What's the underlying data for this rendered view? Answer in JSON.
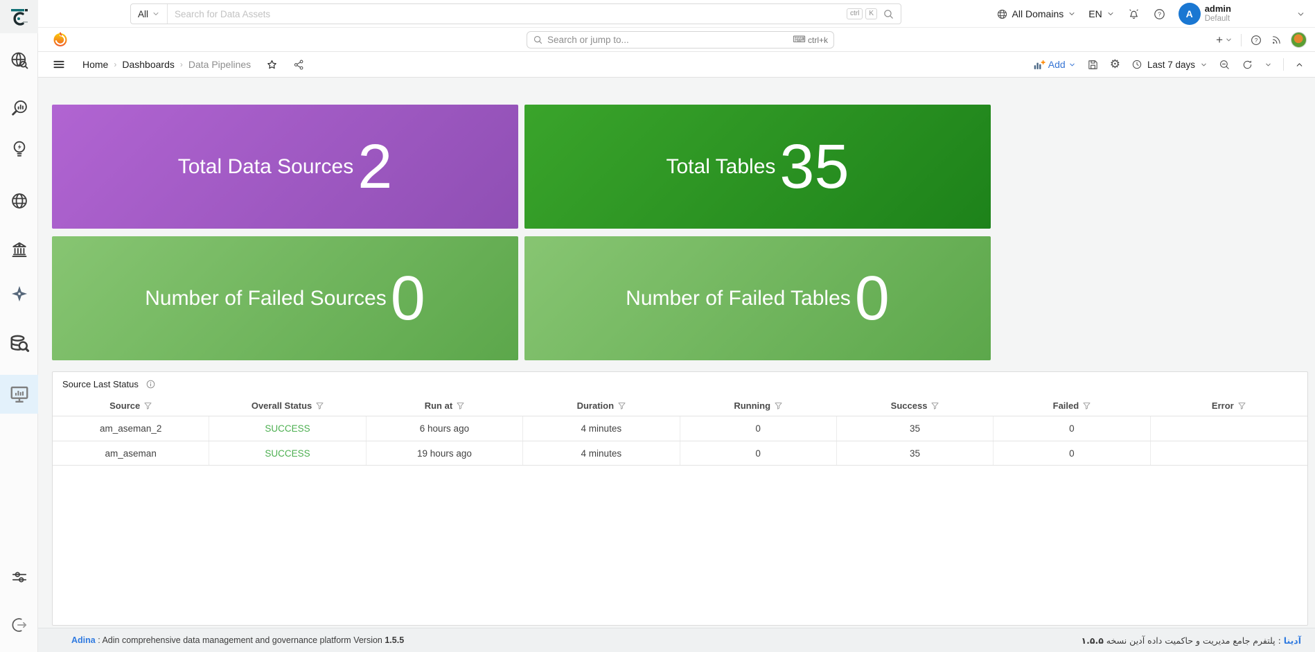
{
  "app_header": {
    "search_filter_label": "All",
    "search_placeholder": "Search for Data Assets",
    "shortcut_ctrl": "ctrl",
    "shortcut_k": "K",
    "domains_label": "All Domains",
    "language_label": "EN",
    "user_initial": "A",
    "user_name": "admin",
    "user_role": "Default"
  },
  "grafana_bar": {
    "search_placeholder": "Search or jump to...",
    "search_shortcut": "ctrl+k",
    "plus_label": "+"
  },
  "dash_toolbar": {
    "breadcrumb": {
      "home": "Home",
      "dashboards": "Dashboards",
      "current": "Data Pipelines"
    },
    "add_label": "Add",
    "time_range_label": "Last 7 days"
  },
  "stat_panels": [
    {
      "label": "Total Data Sources",
      "value": "2"
    },
    {
      "label": "Total Tables",
      "value": "35"
    },
    {
      "label": "Number of Failed Sources",
      "value": "0"
    },
    {
      "label": "Number of Failed Tables",
      "value": "0"
    }
  ],
  "table_panel": {
    "title": "Source Last Status",
    "columns": [
      "Source",
      "Overall Status",
      "Run at",
      "Duration",
      "Running",
      "Success",
      "Failed",
      "Error"
    ],
    "rows": [
      [
        "am_aseman_2",
        "SUCCESS",
        "6 hours ago",
        "4 minutes",
        "0",
        "35",
        "0",
        ""
      ],
      [
        "am_aseman",
        "SUCCESS",
        "19 hours ago",
        "4 minutes",
        "0",
        "35",
        "0",
        ""
      ]
    ]
  },
  "footer": {
    "en": {
      "brand": "Adina",
      "separator": " : ",
      "text": "Adin comprehensive data management and governance platform Version ",
      "version": "1.5.5"
    },
    "fa": {
      "brand": "آدینا",
      "separator": " : ",
      "text": "پلتفرم جامع مدیریت و حاکمیت داده آدین نسخه ",
      "version": "۱.۵.۵"
    }
  },
  "sidebar_icons": [
    "adina-logo",
    "globe-search",
    "profiling-search-chart",
    "insights-bulb",
    "globe",
    "governance-bank",
    "integration-star",
    "database-search",
    "dashboards-monitor",
    "settings-sliders",
    "logout"
  ],
  "colors": {
    "accent_blue": "#3574d4",
    "link_blue": "#2f7ae0",
    "success_green": "#4caf50",
    "avatar_blue": "#1a77d2",
    "panel_purple_from": "#b164d2",
    "panel_purple_to": "#8f4fb4",
    "panel_green_dark_from": "#3aa42b",
    "panel_green_dark_to": "#1d821a",
    "panel_green_light_from": "#87c572",
    "panel_green_light_to": "#5ca74b",
    "grafana_orange": "#f05a28",
    "sidebar_active_bg": "#e3f1fb"
  }
}
